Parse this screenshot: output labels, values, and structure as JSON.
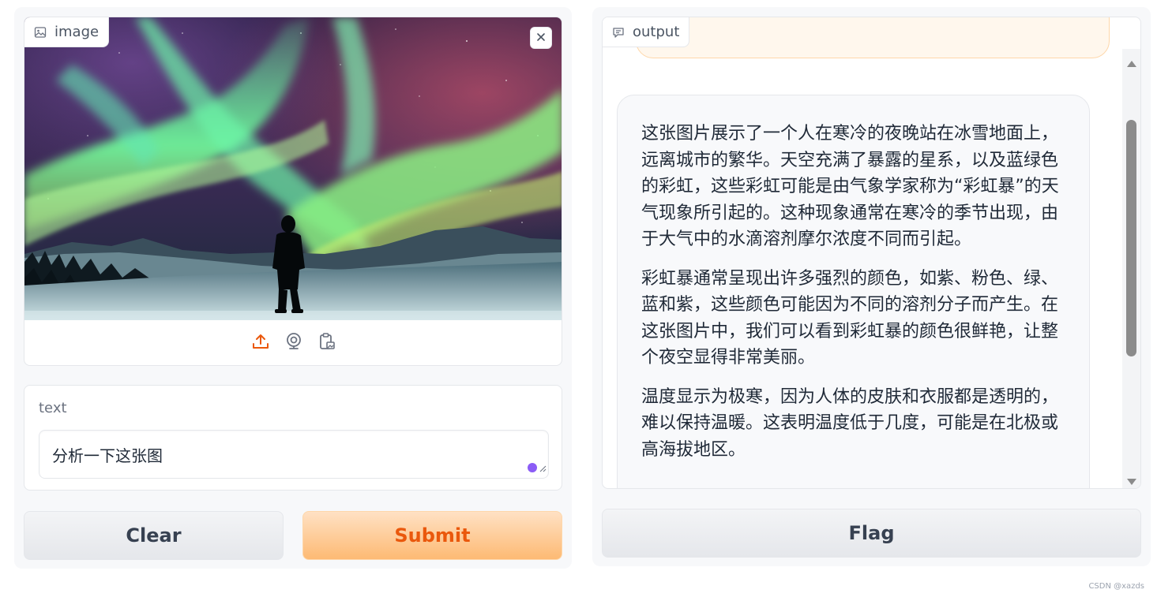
{
  "input": {
    "image_label": "image",
    "text_label": "text",
    "text_value": "分析一下这张图"
  },
  "buttons": {
    "clear": "Clear",
    "submit": "Submit",
    "flag": "Flag"
  },
  "output": {
    "label": "output",
    "paragraphs": [
      "这张图片展示了一个人在寒冷的夜晚站在冰雪地面上，远离城市的繁华。天空充满了暴露的星系，以及蓝绿色的彩虹，这些彩虹可能是由气象学家称为“彩虹暴”的天气现象所引起的。这种现象通常在寒冷的季节出现，由于大气中的水滴溶剂摩尔浓度不同而引起。",
      "彩虹暴通常呈现出许多强烈的颜色，如紫、粉色、绿、蓝和紫，这些颜色可能因为不同的溶剂分子而产生。在这张图片中，我们可以看到彩虹暴的颜色很鲜艳，让整个夜空显得非常美丽。",
      "温度显示为极寒，因为人体的皮肤和衣服都是透明的，难以保持温暖。这表明温度低于几度，可能是在北极或高海拔地区。"
    ]
  },
  "watermark": "CSDN @xazds",
  "colors": {
    "accent": "#ea580c",
    "submit_bg": "#fdba74",
    "scroll_thumb": "#8b8b8b"
  },
  "icons": {
    "image_label": "image-icon",
    "output_label": "chat-icon",
    "close": "close-icon",
    "upload": "upload-icon",
    "webcam": "webcam-icon",
    "clipboard": "clipboard-icon"
  }
}
